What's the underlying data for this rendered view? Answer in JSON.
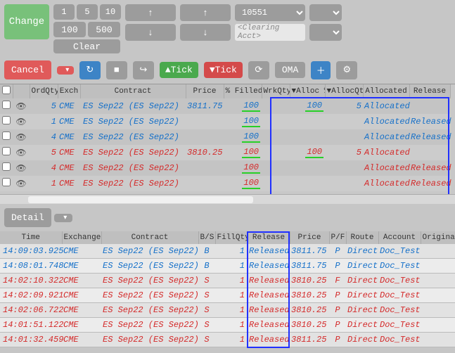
{
  "toolbar": {
    "change": "Change",
    "nums": [
      "1",
      "5",
      "10",
      "100",
      "500"
    ],
    "clear": "Clear",
    "clearing_placeholder": "<Clearing Acct>",
    "combo_value": "10551"
  },
  "toolbar2": {
    "cancel": "Cancel",
    "tick_up": "Tick",
    "tick_down": "Tick",
    "oma": "OMA"
  },
  "orders_headers": [
    "",
    "",
    "OrdQty",
    "Exch",
    "Contract",
    "Price",
    "% Filled",
    "WrkQty",
    "Alloc %",
    "AllocQty",
    "Allocated",
    "Release"
  ],
  "orders": [
    {
      "qty": "5",
      "exch": "CME",
      "contract": "ES Sep22 (ES Sep22)",
      "price": "3811.75",
      "pct": "100",
      "wrk": "",
      "alloc_pct": "100",
      "alloc_qty": "5",
      "allocated": "Allocated",
      "release": "",
      "cls": "blue"
    },
    {
      "qty": "1",
      "exch": "CME",
      "contract": "ES Sep22 (ES Sep22)",
      "price": "",
      "pct": "100",
      "wrk": "",
      "alloc_pct": "",
      "alloc_qty": "",
      "allocated": "Allocated",
      "release": "Released",
      "cls": "blue"
    },
    {
      "qty": "4",
      "exch": "CME",
      "contract": "ES Sep22 (ES Sep22)",
      "price": "",
      "pct": "100",
      "wrk": "",
      "alloc_pct": "",
      "alloc_qty": "",
      "allocated": "Allocated",
      "release": "Released",
      "cls": "blue"
    },
    {
      "qty": "5",
      "exch": "CME",
      "contract": "ES Sep22 (ES Sep22)",
      "price": "3810.25",
      "pct": "100",
      "wrk": "",
      "alloc_pct": "100",
      "alloc_qty": "5",
      "allocated": "Allocated",
      "release": "",
      "cls": "red"
    },
    {
      "qty": "4",
      "exch": "CME",
      "contract": "ES Sep22 (ES Sep22)",
      "price": "",
      "pct": "100",
      "wrk": "",
      "alloc_pct": "",
      "alloc_qty": "",
      "allocated": "Allocated",
      "release": "Released",
      "cls": "red"
    },
    {
      "qty": "1",
      "exch": "CME",
      "contract": "ES Sep22 (ES Sep22)",
      "price": "",
      "pct": "100",
      "wrk": "",
      "alloc_pct": "",
      "alloc_qty": "",
      "allocated": "Allocated",
      "release": "Released",
      "cls": "red"
    }
  ],
  "detail_label": "Detail",
  "fills_headers": [
    "Time",
    "Exchange",
    "Contract",
    "B/S",
    "FillQty",
    "Release",
    "Price",
    "P/F",
    "Route",
    "Account",
    "Originator"
  ],
  "fills": [
    {
      "time": "14:09:03.925",
      "exch": "CME",
      "contract": "ES Sep22 (ES Sep22)",
      "bs": "B",
      "fq": "1",
      "rel": "Released",
      "price": "3811.75",
      "pf": "P",
      "route": "Direct",
      "acct": "Doc_Test",
      "cls": "blue"
    },
    {
      "time": "14:08:01.748",
      "exch": "CME",
      "contract": "ES Sep22 (ES Sep22)",
      "bs": "B",
      "fq": "1",
      "rel": "Released",
      "price": "3811.75",
      "pf": "P",
      "route": "Direct",
      "acct": "Doc_Test",
      "cls": "blue"
    },
    {
      "time": "14:02:10.322",
      "exch": "CME",
      "contract": "ES Sep22 (ES Sep22)",
      "bs": "S",
      "fq": "1",
      "rel": "Released",
      "price": "3810.25",
      "pf": "F",
      "route": "Direct",
      "acct": "Doc_Test",
      "cls": "red"
    },
    {
      "time": "14:02:09.921",
      "exch": "CME",
      "contract": "ES Sep22 (ES Sep22)",
      "bs": "S",
      "fq": "1",
      "rel": "Released",
      "price": "3810.25",
      "pf": "P",
      "route": "Direct",
      "acct": "Doc_Test",
      "cls": "red"
    },
    {
      "time": "14:02:06.722",
      "exch": "CME",
      "contract": "ES Sep22 (ES Sep22)",
      "bs": "S",
      "fq": "1",
      "rel": "Released",
      "price": "3810.25",
      "pf": "P",
      "route": "Direct",
      "acct": "Doc_Test",
      "cls": "red"
    },
    {
      "time": "14:01:51.122",
      "exch": "CME",
      "contract": "ES Sep22 (ES Sep22)",
      "bs": "S",
      "fq": "1",
      "rel": "Released",
      "price": "3810.25",
      "pf": "P",
      "route": "Direct",
      "acct": "Doc_Test",
      "cls": "red"
    },
    {
      "time": "14:01:32.459",
      "exch": "CME",
      "contract": "ES Sep22 (ES Sep22)",
      "bs": "S",
      "fq": "1",
      "rel": "Released",
      "price": "3811.25",
      "pf": "P",
      "route": "Direct",
      "acct": "Doc_Test",
      "cls": "red"
    }
  ]
}
